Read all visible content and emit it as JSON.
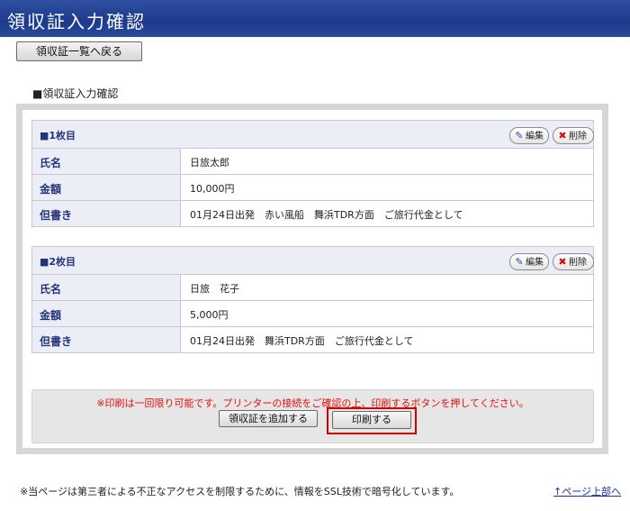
{
  "header": {
    "title": "領収証入力確認"
  },
  "back_button": {
    "label": "領収証一覧へ戻る"
  },
  "section_label": "■領収証入力確認",
  "cards": [
    {
      "title": "■1枚目",
      "edit_label": "編集",
      "delete_label": "削除",
      "rows": [
        {
          "label": "氏名",
          "value": "日旅太郎"
        },
        {
          "label": "金額",
          "value": "10,000円"
        },
        {
          "label": "但書き",
          "value": "01月24日出発　赤い風船　舞浜TDR方面　ご旅行代金として"
        }
      ]
    },
    {
      "title": "■2枚目",
      "edit_label": "編集",
      "delete_label": "削除",
      "rows": [
        {
          "label": "氏名",
          "value": "日旅　花子"
        },
        {
          "label": "金額",
          "value": "5,000円"
        },
        {
          "label": "但書き",
          "value": "01月24日出発　舞浜TDR方面　ご旅行代金として"
        }
      ]
    }
  ],
  "notice": "※印刷は一回限り可能です。プリンターの接続をご確認の上、印刷するボタンを押してください。",
  "buttons": {
    "add": "領収証を追加する",
    "print": "印刷する"
  },
  "footer": {
    "note": "※当ページは第三者による不正なアクセスを制限するために、情報をSSL技術で暗号化しています。",
    "page_top": "↑ページ上部へ"
  },
  "icons": {
    "edit": "pencil-icon",
    "delete": "x-icon"
  },
  "colors": {
    "header_bg": "#1d3a8a",
    "label_text": "#26347a",
    "notice_text": "#e01010",
    "highlight_border": "#d20000"
  }
}
